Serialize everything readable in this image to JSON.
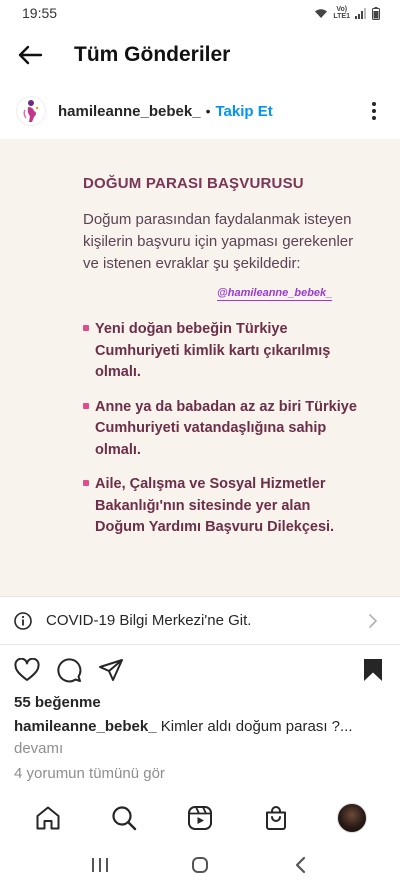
{
  "status_bar": {
    "time": "19:55",
    "network_label_1": "Vo)",
    "network_label_2": "LTE1"
  },
  "header": {
    "title": "Tüm Gönderiler"
  },
  "post": {
    "username": "hamileanne_bebek_",
    "separator": "•",
    "follow_label": "Takip Et",
    "image": {
      "title": "DOĞUM PARASI BAŞVURUSU",
      "intro": "Doğum parasından faydalanmak isteyen kişilerin başvuru için yapması gerekenler ve istenen evraklar şu şekildedir:",
      "tag": "@hamileanne_bebek_",
      "items": [
        "Yeni doğan bebeğin Türkiye Cumhuriyeti kimlik kartı çıkarılmış olmalı.",
        "Anne ya da babadan az az biri Türkiye Cumhuriyeti vatandaşlığına sahip olmalı.",
        "Aile, Çalışma ve Sosyal Hizmetler Bakanlığı'nın sitesinde yer alan Doğum Yardımı Başvuru Dilekçesi."
      ]
    },
    "covid_banner": "COVID-19 Bilgi Merkezi'ne Git.",
    "likes": "55 beğenme",
    "caption_user": "hamileanne_bebek_",
    "caption_text": "Kimler aldı doğum parası ?...",
    "caption_more": "devamı",
    "comments_link": "4 yorumun tümünü gör"
  },
  "colors": {
    "follow_blue": "#0095f6",
    "card_background": "#f8f3ec",
    "card_title": "#7a3557",
    "bullet_pink": "#e04c8f",
    "tag_purple": "#9b3bd2"
  },
  "icons": {
    "header": [
      "back-arrow-icon"
    ],
    "actions": [
      "heart-icon",
      "comment-icon",
      "share-icon",
      "bookmark-icon"
    ],
    "bottom_nav": [
      "home-icon",
      "search-icon",
      "reels-icon",
      "shop-icon",
      "profile-avatar"
    ],
    "system_nav": [
      "recent-apps-icon",
      "home-circle-icon",
      "back-chevron-icon"
    ]
  }
}
